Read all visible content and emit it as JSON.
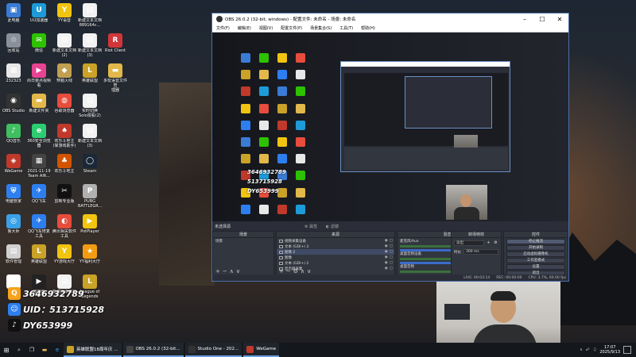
{
  "desktop": {
    "columns": [
      [
        {
          "label": "此电脑",
          "color": "#3a7bd5",
          "glyph": "▣"
        },
        {
          "label": "回收站",
          "color": "#8a9099",
          "glyph": "♲"
        },
        {
          "label": "232323",
          "color": "#e8e8e8",
          "glyph": "▦"
        },
        {
          "label": "OBS Studio",
          "color": "#333333",
          "glyph": "◉"
        },
        {
          "label": "QQ音乐",
          "color": "#3fbf5f",
          "glyph": "♪"
        },
        {
          "label": "WeGame",
          "color": "#c0392b",
          "glyph": "◈"
        },
        {
          "label": "电脑管家",
          "color": "#2d7ff0",
          "glyph": "⛨"
        },
        {
          "label": "鲁大师",
          "color": "#3aa0e8",
          "glyph": "◎"
        },
        {
          "label": "软件管理",
          "color": "#d0d0d0",
          "glyph": "▤"
        },
        {
          "label": "腾讯",
          "color": "#ffffff",
          "glyph": "✓"
        }
      ],
      [
        {
          "label": "UU加速器",
          "color": "#1d9bd8",
          "glyph": "U"
        },
        {
          "label": "微信",
          "color": "#2dc100",
          "glyph": "✉"
        },
        {
          "label": "尚日要点视频\n看",
          "color": "#e84393",
          "glyph": "▶"
        },
        {
          "label": "新建文件夹",
          "color": "#e2b84a",
          "glyph": "▬"
        },
        {
          "label": "360安全浏览\n器",
          "color": "#2ecc71",
          "glyph": "e"
        },
        {
          "label": "2021-11-19\nTeam AIR...",
          "color": "#444444",
          "glyph": "▦"
        },
        {
          "label": "QQ飞车",
          "color": "#2d7ff0",
          "glyph": "✈"
        },
        {
          "label": "QQ飞车修复\n工具",
          "color": "#2d7ff0",
          "glyph": "✈"
        },
        {
          "label": "英雄联盟",
          "color": "#c9a227",
          "glyph": "L"
        },
        {
          "label": "播放器",
          "color": "#222222",
          "glyph": "▶"
        }
      ],
      [
        {
          "label": "YY语音",
          "color": "#f1c40f",
          "glyph": "Y"
        },
        {
          "label": "新建文本文档\n(2)",
          "color": "#f2f2f2",
          "glyph": "▤"
        },
        {
          "label": "穿越火线",
          "color": "#c0a050",
          "glyph": "◆"
        },
        {
          "label": "谷歌浏览器",
          "color": "#e74c3c",
          "glyph": "◍"
        },
        {
          "label": "欢乐斗地主\n(掌游戏助手)",
          "color": "#c0392b",
          "glyph": "♠"
        },
        {
          "label": "欢乐斗地主",
          "color": "#d35400",
          "glyph": "♣"
        },
        {
          "label": "剪映专业版",
          "color": "#111111",
          "glyph": "✂"
        },
        {
          "label": "腾讯相关软件\n工具",
          "color": "#e74c3c",
          "glyph": "◐"
        },
        {
          "label": "YY游戏大厅",
          "color": "#f1c40f",
          "glyph": "Y"
        },
        {
          "label": "新建文本文档",
          "color": "#f2f2f2",
          "glyph": "▤"
        }
      ],
      [
        {
          "label": "新建文本文档\n889164c...",
          "color": "#f2f2f2",
          "glyph": "▤"
        },
        {
          "label": "新建文本文档\n(3)",
          "color": "#f2f2f2",
          "glyph": "▤"
        },
        {
          "label": "英雄联盟",
          "color": "#c9a227",
          "glyph": "L"
        },
        {
          "label": "实时切换\nSolo观看(2)",
          "color": "#f2f2f2",
          "glyph": "▤"
        },
        {
          "label": "新建文本文档\n(3)",
          "color": "#f2f2f2",
          "glyph": "▤"
        },
        {
          "label": "Steam",
          "color": "#1b2838",
          "glyph": "◯"
        },
        {
          "label": "PUBG\nBATTLEGR...",
          "color": "#b0b0b0",
          "glyph": "P"
        },
        {
          "label": "PotPlayer",
          "color": "#f1c40f",
          "glyph": "▶"
        },
        {
          "label": "YY福利大厅",
          "color": "#f39c12",
          "glyph": "★"
        },
        {
          "label": "League of\nLegends",
          "color": "#c9a227",
          "glyph": "L"
        }
      ],
      [
        {
          "label": "",
          "color": "rgba(0,0,0,0)",
          "glyph": ""
        },
        {
          "label": "Riot Client",
          "color": "#d13639",
          "glyph": "R"
        },
        {
          "label": "多玩语音文件管\n理器",
          "color": "#e2b84a",
          "glyph": "▬"
        }
      ]
    ]
  },
  "overlay": {
    "qq_id": "3646932789",
    "uid": "UID：513715928",
    "douyin_id": "DY653999"
  },
  "obs": {
    "title": "OBS 26.0.2 (32-bit, windows) - 配置文件: 未命名 - 场景: 未命名",
    "menu": [
      "文件(F)",
      "编辑(E)",
      "视图(V)",
      "配置文件(P)",
      "场景集合(S)",
      "工具(T)",
      "帮助(H)"
    ],
    "preview_ids": [
      "3646932789",
      "513715928",
      "DY653999"
    ],
    "no_source_selected": "未选择源",
    "properties_btn": "属性",
    "filters_btn": "滤镜",
    "scenes": {
      "title": "场景",
      "items": [
        "场景"
      ]
    },
    "sources": {
      "title": "来源",
      "items": [
        {
          "name": "视频采集设备",
          "selected": false
        },
        {
          "name": "文本 (GDI+) 3",
          "selected": false
        },
        {
          "name": "图像 2",
          "selected": true
        },
        {
          "name": "图像",
          "selected": false
        },
        {
          "name": "文本 (GDI+) 2",
          "selected": false
        },
        {
          "name": "显示器采集",
          "selected": false
        }
      ]
    },
    "mixer": {
      "title": "混音器",
      "channels": [
        {
          "name": "麦克风/Aux",
          "level": "0.0 dB"
        },
        {
          "name": "桌面音频设备",
          "level": "0.0 dB"
        },
        {
          "name": "桌面音频",
          "level": "0.0 dB"
        }
      ]
    },
    "transitions": {
      "title": "转场特效",
      "type": "淡出",
      "duration_label": "时长",
      "duration": "300 ms"
    },
    "controls": {
      "title": "控件",
      "buttons": [
        "停止推流",
        "开始录制",
        "启动虚拟摄像机",
        "工作室模式",
        "设置",
        "退出"
      ]
    },
    "status": {
      "live": "LIVE: 00:03:14",
      "rec": "REC: 00:00:00",
      "cpu": "CPU: 3.7%, 60.00 fps"
    }
  },
  "taskbar": {
    "apps": [
      {
        "label": "英雄联盟18周年庆 ...",
        "color": "#c9a227"
      },
      {
        "label": "OBS 26.0.2 (32-bit...",
        "color": "#444444"
      },
      {
        "label": "Studio One - 202...",
        "color": "#333333"
      },
      {
        "label": "WeGame",
        "color": "#c0392b"
      }
    ],
    "time": "17:07",
    "date": "2025/9/13"
  }
}
